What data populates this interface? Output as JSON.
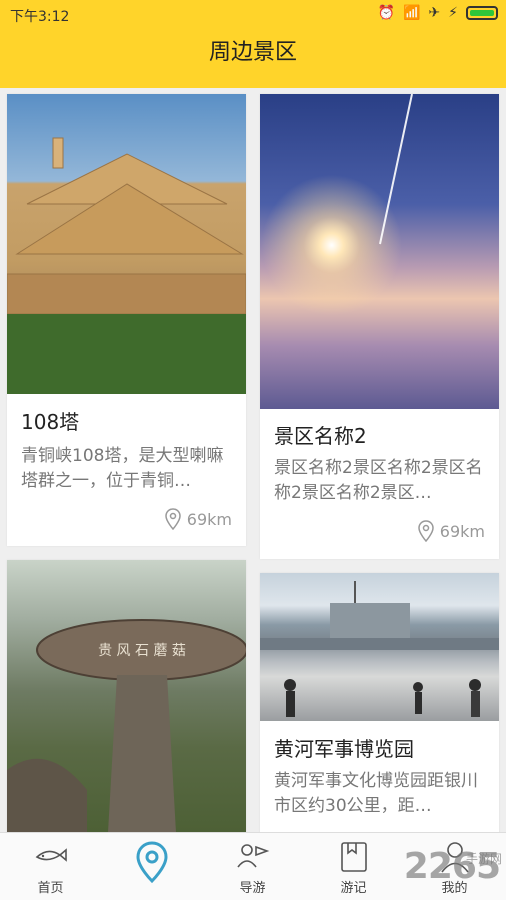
{
  "status": {
    "time": "下午3:12"
  },
  "header": {
    "title": "周边景区"
  },
  "cards": [
    {
      "name": "108塔",
      "desc": "青铜峡108塔，是大型喇嘛塔群之一，位于青铜…",
      "distance": "69km"
    },
    {
      "name": "景区名称2",
      "desc": "景区名称2景区名称2景区名称2景区名称2景区…",
      "distance": "69km"
    },
    {
      "name": "",
      "desc": "",
      "distance": ""
    },
    {
      "name": "黄河军事博览园",
      "desc": "黄河军事文化博览园距银川市区约30公里，距…",
      "distance": ""
    }
  ],
  "rock_sign": "贵 风 石 蘑 菇",
  "nav": [
    {
      "label": "首页"
    },
    {
      "label": ""
    },
    {
      "label": "导游"
    },
    {
      "label": "游记"
    },
    {
      "label": "我的"
    }
  ],
  "watermark": {
    "big": "2265",
    "small": "手游网"
  },
  "colors": {
    "accent": "#ffd42a",
    "nav_active": "#3aa0c8"
  }
}
